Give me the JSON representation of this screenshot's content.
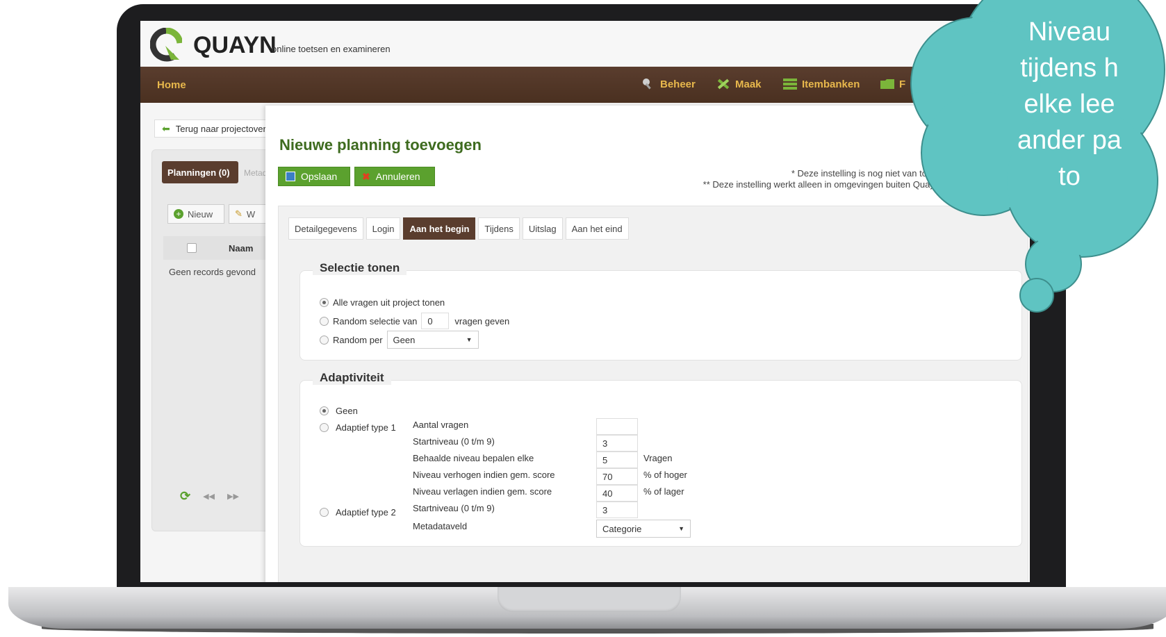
{
  "app": {
    "brand": "QUAYN",
    "tagline": "online toetsen en examineren"
  },
  "nav": {
    "home": "Home",
    "beheer": "Beheer",
    "maak": "Maak",
    "itembanken": "Itembanken",
    "more": "F"
  },
  "background_page": {
    "back_button": "Terug naar projectover",
    "tab_planningen": "Planningen (0)",
    "tab_meta": "Metad",
    "btn_new": "Nieuw",
    "btn_edit": "W",
    "col_naam": "Naam",
    "no_records": "Geen records gevond"
  },
  "modal": {
    "title": "Nieuwe planning toevoegen",
    "save_label": "Opslaan",
    "cancel_label": "Annuleren",
    "note1": "* Deze instelling is nog niet van toepassing",
    "note2": "** Deze instelling werkt alleen in omgevingen buiten Quayn zoals",
    "tabs": [
      "Detailgegevens",
      "Login",
      "Aan het begin",
      "Tijdens",
      "Uitslag",
      "Aan het eind"
    ],
    "active_tab": "Aan het begin"
  },
  "selectie": {
    "legend": "Selectie tonen",
    "opt_all": "Alle vragen uit project tonen",
    "opt_random": "Random selectie van",
    "random_value": "0",
    "random_suffix": "vragen geven",
    "opt_random_per": "Random per",
    "random_per_value": "Geen",
    "selected": "Alle vragen uit project tonen"
  },
  "adaptiviteit": {
    "legend": "Adaptiviteit",
    "opt_geen": "Geen",
    "opt_type1": "Adaptief type 1",
    "opt_type2": "Adaptief type 2",
    "selected": "Geen",
    "fields": {
      "aantal_vragen": {
        "label": "Aantal vragen",
        "value": ""
      },
      "startniveau": {
        "label": "Startniveau (0 t/m 9)",
        "value": "3"
      },
      "behaalde": {
        "label": "Behaalde niveau bepalen elke",
        "value": "5",
        "suffix": "Vragen"
      },
      "verhogen": {
        "label": "Niveau verhogen indien gem. score",
        "value": "70",
        "suffix": "% of hoger"
      },
      "verlagen": {
        "label": "Niveau verlagen indien gem. score",
        "value": "40",
        "suffix": "% of lager"
      },
      "startniveau2": {
        "label": "Startniveau (0 t/m 9)",
        "value": "3"
      },
      "metadataveld": {
        "label": "Metadataveld",
        "value": "Categorie"
      }
    }
  },
  "bubble": {
    "text": "Niveau\ntijdens h\nelke lee\nander pa\nto"
  },
  "colors": {
    "brand_brown": "#5a3d2e",
    "nav_gold": "#e8b84c",
    "green_button": "#5ba12e",
    "bubble_teal": "#5fc4c2"
  }
}
